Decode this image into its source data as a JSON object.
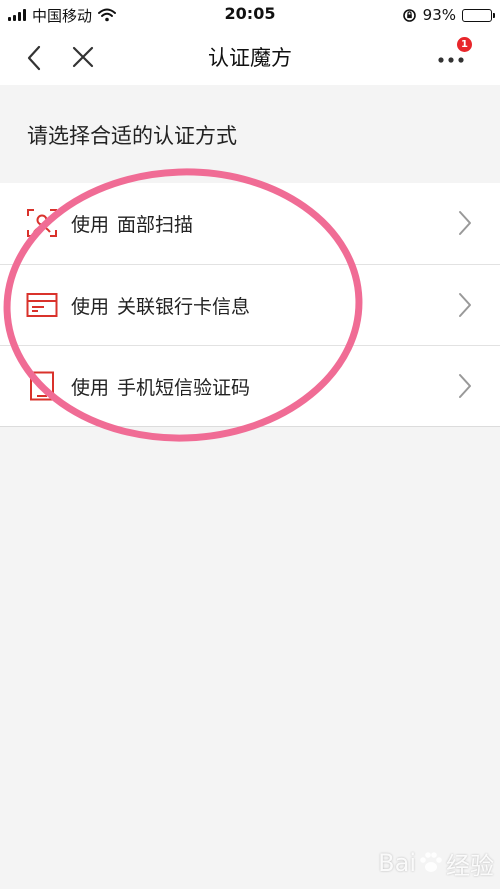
{
  "status_bar": {
    "carrier": "中国移动",
    "time": "20:05",
    "battery": "93%",
    "battery_level": 0.93
  },
  "nav": {
    "title": "认证魔方",
    "badge_count": "1"
  },
  "section_title": "请选择合适的认证方式",
  "options": [
    {
      "prefix": "使用",
      "label": "面部扫描",
      "icon": "face-scan-icon"
    },
    {
      "prefix": "使用",
      "label": "关联银行卡信息",
      "icon": "bank-card-icon"
    },
    {
      "prefix": "使用",
      "label": "手机短信验证码",
      "icon": "phone-icon"
    }
  ],
  "colors": {
    "accent_red": "#d9322b",
    "annotation_pink": "#f06c95",
    "badge_red": "#e8262b"
  },
  "watermark": {
    "text": "Bai",
    "brand": "经验"
  }
}
